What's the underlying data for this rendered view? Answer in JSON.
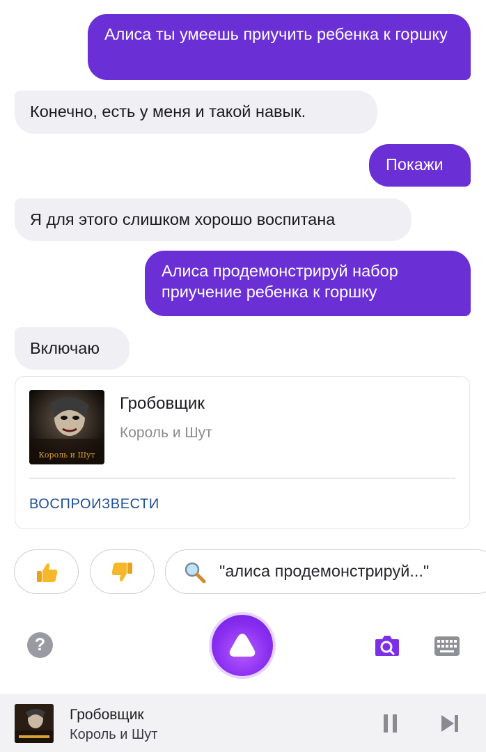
{
  "messages": [
    {
      "from": "user",
      "text": "Алиса ты умеешь приучить ребенка к горшку"
    },
    {
      "from": "alice",
      "text": "Конечно, есть у меня и такой навык."
    },
    {
      "from": "user",
      "text": "Покажи"
    },
    {
      "from": "alice",
      "text": "Я для этого слишком хорошо воспитана"
    },
    {
      "from": "user",
      "text": "Алиса продемонстрируй набор приучение ребенка к горшку"
    },
    {
      "from": "alice",
      "text": "Включаю"
    }
  ],
  "track_card": {
    "title": "Гробовщик",
    "artist": "Король и Шут",
    "cover_text": "Король и Шут",
    "action_label": "ВОСПРОИЗВЕСТИ"
  },
  "suggestions": {
    "like_icon": "thumbs-up-icon",
    "dislike_icon": "thumbs-down-icon",
    "query": "\"алиса продемонстрируй...\""
  },
  "bottom_bar": {
    "help_label": "?",
    "icons": [
      "help-icon",
      "alice-icon",
      "camera-search-icon",
      "keyboard-icon"
    ]
  },
  "player": {
    "title": "Гробовщик",
    "artist": "Король и Шут"
  },
  "colors": {
    "user_bubble": "#6b2fd6",
    "alice_bubble": "#f0f0f4",
    "accent": "#8a2ef0",
    "link": "#1f4d96"
  }
}
